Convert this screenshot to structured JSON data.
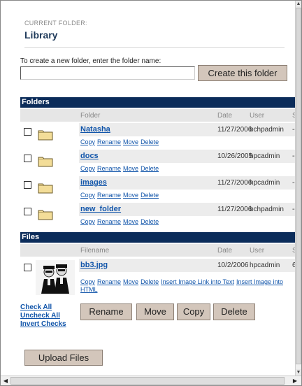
{
  "header": {
    "crumb": "CURRENT FOLDER:",
    "title": "Library"
  },
  "create": {
    "label": "To create a new folder, enter the folder name:",
    "value": "",
    "button": "Create this folder"
  },
  "folders_section": {
    "title": "Folders",
    "columns": {
      "name": "Folder",
      "date": "Date",
      "user": "User",
      "size": "S"
    },
    "items": [
      {
        "name": "Natasha",
        "date": "11/27/2006",
        "user": "bchpadmin",
        "size": "--"
      },
      {
        "name": "docs",
        "date": "10/26/2005",
        "user": "hpcadmin",
        "size": "--"
      },
      {
        "name": "images",
        "date": "11/27/2006",
        "user": "hpcadmin",
        "size": "--"
      },
      {
        "name": "new_folder",
        "date": "11/27/2006",
        "user": "bchpadmin",
        "size": "--"
      }
    ],
    "actions": {
      "copy": "Copy",
      "rename": "Rename",
      "move": "Move",
      "delete": "Delete"
    }
  },
  "files_section": {
    "title": "Files",
    "columns": {
      "name": "Filename",
      "date": "Date",
      "user": "User",
      "size": "S"
    },
    "items": [
      {
        "name": "bb3.jpg",
        "date": "10/2/2006",
        "user": "hpcadmin",
        "size": "6"
      }
    ],
    "actions": {
      "copy": "Copy",
      "rename": "Rename",
      "move": "Move",
      "delete": "Delete",
      "insert_link": "Insert Image Link into Text",
      "insert_image": "Insert Image into HTML"
    }
  },
  "bulk": {
    "check_all": "Check All",
    "uncheck_all": "Uncheck All",
    "invert": "Invert Checks",
    "rename": "Rename",
    "move": "Move",
    "copy": "Copy",
    "delete": "Delete"
  },
  "upload": {
    "button": "Upload Files"
  },
  "colors": {
    "section_bar": "#0b2c5a",
    "link": "#1155aa",
    "button": "#d3c6bb",
    "title": "#1f3a5a",
    "folder_icon": "#f3dd98"
  },
  "icons": [
    "folder-icon",
    "file-thumbnail",
    "scroll-up-icon",
    "scroll-down-icon",
    "scroll-left-icon",
    "scroll-right-icon"
  ]
}
